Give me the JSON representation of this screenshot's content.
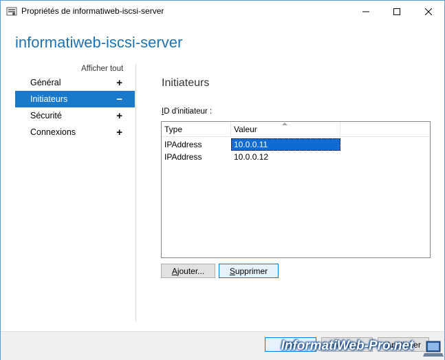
{
  "window": {
    "title": "Propriétés de informatiweb-iscsi-server",
    "icon": "server-properties-icon"
  },
  "header": {
    "server_name": "informatiweb-iscsi-server"
  },
  "sidebar": {
    "show_all": "Afficher tout",
    "items": [
      {
        "label": "Général",
        "sign": "+"
      },
      {
        "label": "Initiateurs",
        "sign": "−"
      },
      {
        "label": "Sécurité",
        "sign": "+"
      },
      {
        "label": "Connexions",
        "sign": "+"
      }
    ],
    "selected_index": 1
  },
  "main": {
    "section_title": "Initiateurs",
    "id_label_first": "I",
    "id_label_rest": "D d'initiateur :",
    "list": {
      "columns": [
        "Type",
        "Valeur"
      ],
      "rows": [
        {
          "type": "IPAddress",
          "value": "10.0.0.11"
        },
        {
          "type": "IPAddress",
          "value": "10.0.0.12"
        }
      ],
      "selected_index": 0
    },
    "add_button_first": "A",
    "add_button_rest": "jouter...",
    "remove_button_first": "S",
    "remove_button_rest": "upprimer"
  },
  "footer": {
    "ok": "OK",
    "cancel": "Annuler",
    "apply": "Appliquer"
  },
  "watermark": {
    "text": "InformatiWeb-Pro.net"
  },
  "colors": {
    "accent": "#1979ca",
    "title_blue": "#1e73b5",
    "selection": "#0f6bd4"
  }
}
